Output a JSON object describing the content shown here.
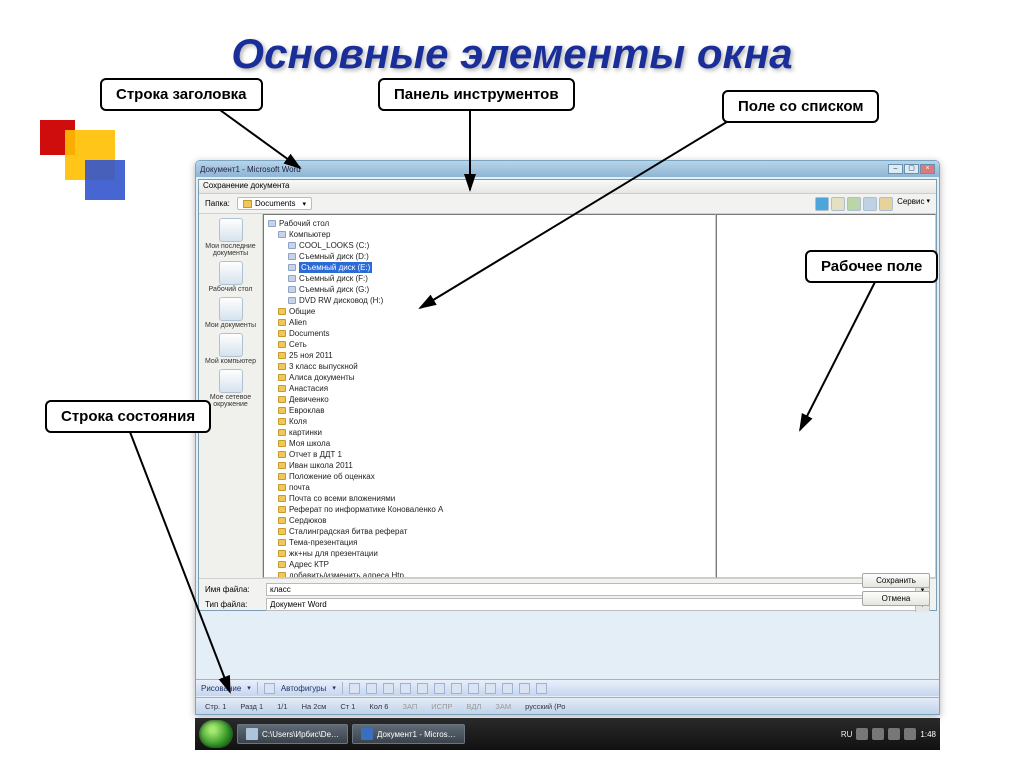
{
  "title": "Основные элементы окна",
  "callouts": {
    "title_bar": "Строка заголовка",
    "toolbar": "Панель инструментов",
    "combo": "Поле со списком",
    "work_area": "Рабочее поле",
    "status_bar": "Строка состояния"
  },
  "app": {
    "window_title": "Документ1 - Microsoft Word",
    "dialog_title": "Сохранение документа",
    "path_label": "Папка:",
    "current_folder": "Documents",
    "service_label": "Сервис",
    "places": {
      "recent": "Мои последние документы",
      "desktop": "Рабочий стол",
      "mydocs": "Мои документы",
      "mycomp": "Мой компьютер",
      "network": "Мое сетевое окружение"
    },
    "tree": {
      "root": "Рабочий стол",
      "computer": "Компьютер",
      "drives": [
        "COOL_LOOKS (C:)",
        "Съемный диск (D:)",
        "Съемный диск (E:)",
        "Съемный диск (F:)",
        "Съемный диск (G:)",
        "DVD RW дисковод (H:)"
      ],
      "selected": "Съемный диск (E:)",
      "folders": [
        "Общие",
        "Alien",
        "Documents",
        "Сеть",
        "25 ноя 2011",
        "3 класс выпускной",
        "Алиса документы",
        "Анастасия",
        "Девиченко",
        "Евроклав",
        "Коля",
        "картинки",
        "Моя школа",
        "Отчет в ДДТ 1",
        "Иван школа 2011",
        "Положение об оценках",
        "почта",
        "Почта со всеми вложениями",
        "Реферат по информатике Коноваленко А",
        "Сердюков",
        "Сталинградская битва реферат",
        "Тема-презентация",
        "жк+ны для презентации",
        "Адрес КТР",
        "добавить/изменить адреса Htр"
      ]
    },
    "footer": {
      "file_name_label": "Имя файла:",
      "file_name_value": "класс",
      "file_type_label": "Тип файла:",
      "file_type_value": "Документ Word",
      "save_btn": "Сохранить",
      "cancel_btn": "Отмена"
    },
    "drawing_toolbar": {
      "label": "Рисование",
      "autoshapes": "Автофигуры"
    },
    "status": {
      "page": "Стр. 1",
      "section": "Разд 1",
      "pages": "1/1",
      "at": "На 2см",
      "line": "Ст 1",
      "col": "Кол 6",
      "zap": "ЗАП",
      "ispr": "ИСПР",
      "vdl": "ВДЛ",
      "zam": "ЗАМ",
      "lang": "русский (Ро"
    }
  },
  "taskbar": {
    "task1": "C:\\Users\\Ирбис\\De…",
    "task2": "Документ1 - Micros…",
    "lang": "RU",
    "clock": "1:48"
  }
}
